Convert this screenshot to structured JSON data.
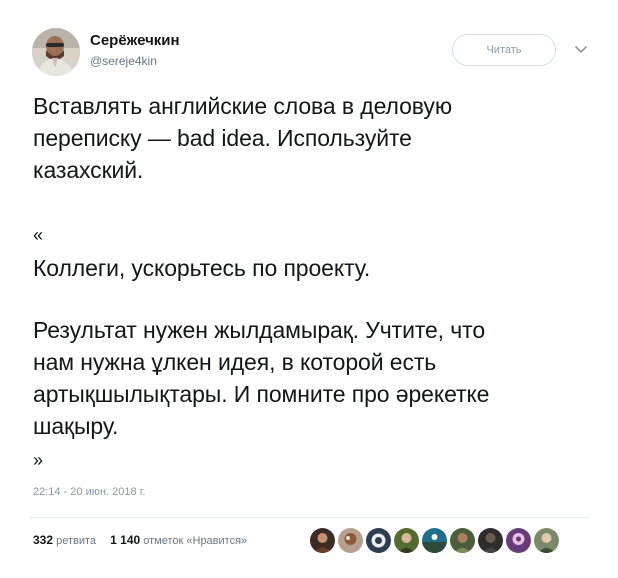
{
  "author": {
    "display_name": "Серёжечкин",
    "handle": "@sereje4kin"
  },
  "header": {
    "follow_label": "Читать"
  },
  "tweet": {
    "lines_intro": [
      "Вставлять английские слова в деловую",
      "переписку — bad idea. Используйте",
      "казахский."
    ],
    "quote_open": "«",
    "line_colleagues": "Коллеги, ускорьтесь по проекту.",
    "lines_main": [
      "Результат нужен жылдамырақ. Учтите, что",
      "нам нужна ұлкен идея, в которой есть",
      "артықшылықтары. И помните про әрекетке",
      "шақыру."
    ],
    "quote_close": "»"
  },
  "timestamp": "22:14 - 20 июн. 2018 г.",
  "stats": {
    "retweets_count": "332",
    "retweets_label": "ретвита",
    "likes_count": "1 140",
    "likes_label": "отметок «Нравится»"
  },
  "colors": {
    "text": "#14171a",
    "secondary": "#657786",
    "divider": "#e6ecf0",
    "button_border": "#d7dee3"
  }
}
